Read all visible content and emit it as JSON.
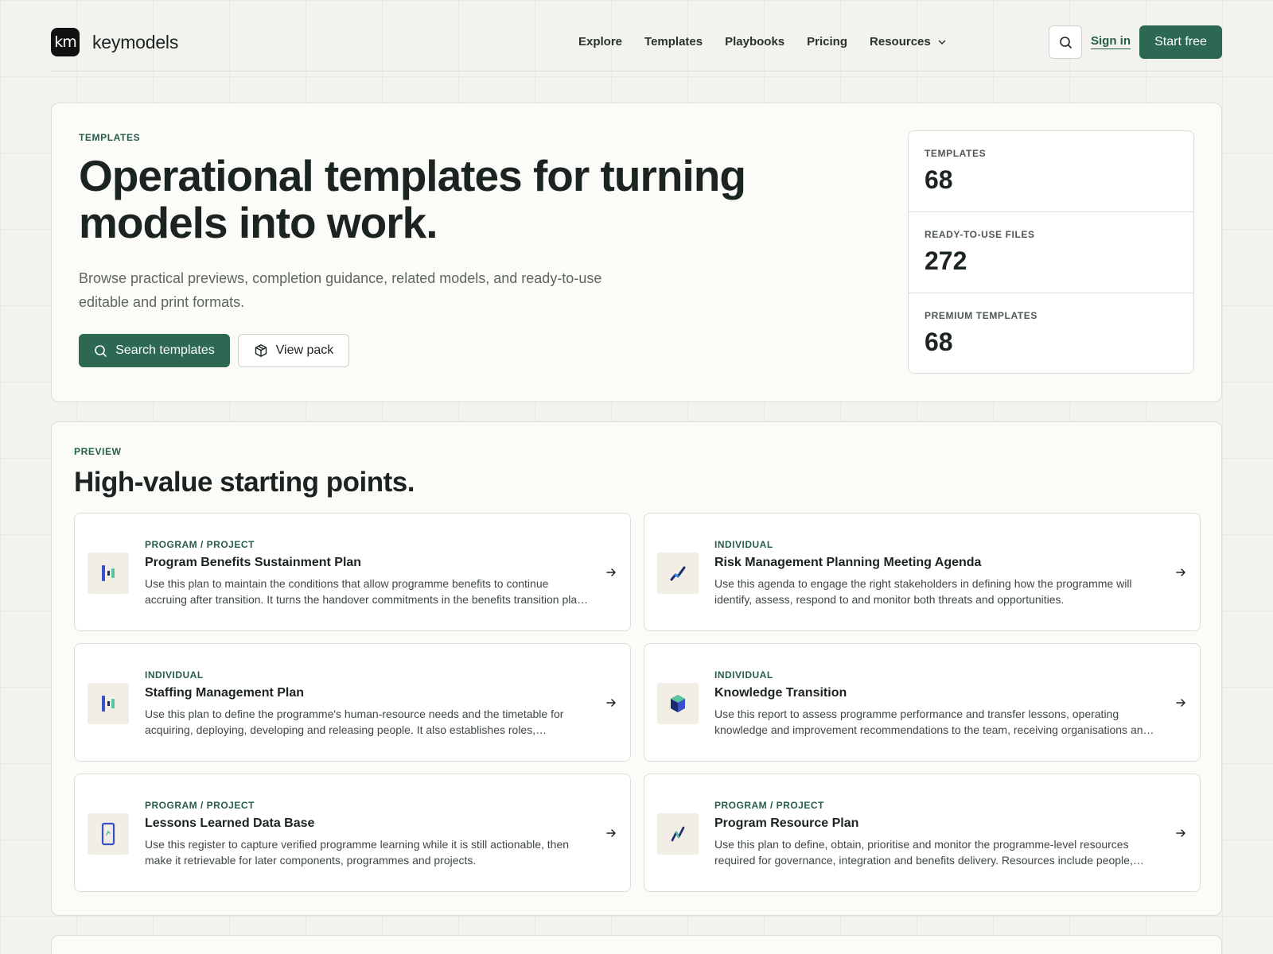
{
  "brand": {
    "mark": "km",
    "name": "keymodels"
  },
  "nav": {
    "items": [
      "Explore",
      "Templates",
      "Playbooks",
      "Pricing"
    ],
    "resources": "Resources",
    "sign_in": "Sign in",
    "start_free": "Start free"
  },
  "hero": {
    "eyebrow": "TEMPLATES",
    "title": "Operational templates for turning models into work.",
    "description": "Browse practical previews, completion guidance, related models, and ready-to-use editable and print formats.",
    "search_button": "Search templates",
    "view_pack_button": "View pack",
    "stats": [
      {
        "label": "TEMPLATES",
        "value": "68"
      },
      {
        "label": "READY-TO-USE FILES",
        "value": "272"
      },
      {
        "label": "PREMIUM TEMPLATES",
        "value": "68"
      }
    ]
  },
  "preview": {
    "eyebrow": "PREVIEW",
    "title": "High-value starting points.",
    "cards": [
      {
        "category": "PROGRAM / PROJECT",
        "title": "Program Benefits Sustainment Plan",
        "description": "Use this plan to maintain the conditions that allow programme benefits to continue accruing after transition. It turns the handover commitments in the benefits transition plan into owned activities.",
        "icon": "bars-icon"
      },
      {
        "category": "INDIVIDUAL",
        "title": "Risk Management Planning Meeting Agenda",
        "description": "Use this agenda to engage the right stakeholders in defining how the programme will identify, assess, respond to and monitor both threats and opportunities.",
        "icon": "trend-line-icon"
      },
      {
        "category": "INDIVIDUAL",
        "title": "Staffing Management Plan",
        "description": "Use this plan to define the programme's human-resource needs and the timetable for acquiring, deploying, developing and releasing people. It also establishes roles, responsibilities and reporting lines.",
        "icon": "bars-icon"
      },
      {
        "category": "INDIVIDUAL",
        "title": "Knowledge Transition",
        "description": "Use this report to assess programme performance and transfer lessons, operating knowledge and improvement recommendations to the team, receiving organisations and sponsors.",
        "icon": "cube-icon"
      },
      {
        "category": "PROGRAM / PROJECT",
        "title": "Lessons Learned Data Base",
        "description": "Use this register to capture verified programme learning while it is still actionable, then make it retrievable for later components, programmes and projects.",
        "icon": "phone-icon"
      },
      {
        "category": "PROGRAM / PROJECT",
        "title": "Program Resource Plan",
        "description": "Use this plan to define, obtain, prioritise and monitor the programme-level resources required for governance, integration and benefits delivery. Resources include people, facilities, equipment and funding.",
        "icon": "zigzag-icon"
      }
    ]
  },
  "colors": {
    "accent": "#2c6852",
    "accent_text": "#275e4a",
    "background": "#f2f2ee",
    "panel": "#fbfbf8"
  }
}
